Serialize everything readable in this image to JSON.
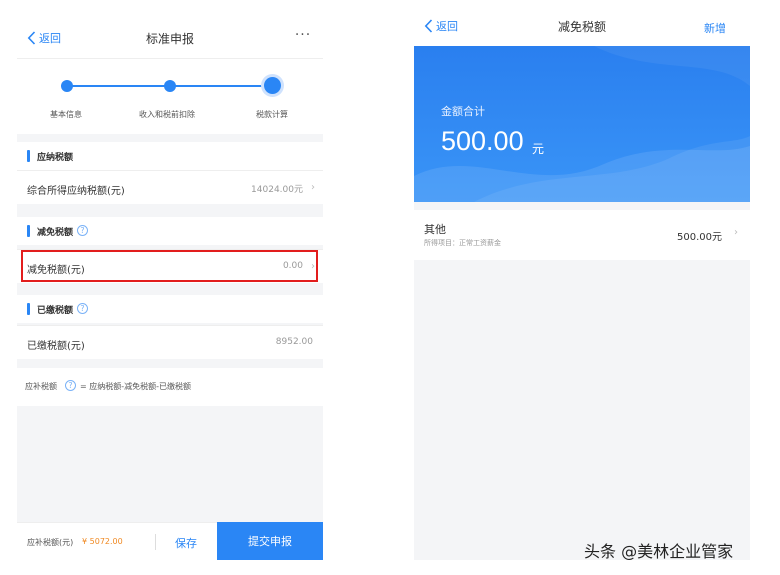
{
  "left": {
    "nav": {
      "back_label": "返回",
      "title": "标准申报",
      "more": "···"
    },
    "steps": [
      {
        "label": "基本信息"
      },
      {
        "label": "收入和税前扣除"
      },
      {
        "label": "税款计算"
      }
    ],
    "sections": {
      "payable": {
        "title": "应纳税额",
        "row_label": "综合所得应纳税额(元)",
        "row_value": "14024.00元"
      },
      "relief": {
        "title": "减免税额",
        "row_label": "减免税额(元)",
        "row_value": "0.00"
      },
      "paid": {
        "title": "已缴税额",
        "row_label": "已缴税额(元)",
        "row_value": "8952.00"
      }
    },
    "formula": {
      "prefix": "应补税额",
      "help": "?",
      "equation": "= 应纳税额-减免税额-已缴税额"
    },
    "footer": {
      "label": "应补税额(元)",
      "amount": "¥ 5072.00",
      "save": "保存",
      "submit": "提交申报"
    }
  },
  "right": {
    "nav": {
      "back_label": "返回",
      "title": "减免税额",
      "action": "新增"
    },
    "hero": {
      "label": "金额合计",
      "amount": "500.00",
      "unit": "元"
    },
    "item": {
      "title": "其他",
      "subtitle": "所得项目：正常工资薪金",
      "value": "500.00元"
    }
  },
  "watermark": "头条 @美林企业管家",
  "colors": {
    "accent": "#2a86f5",
    "highlight": "#e21d1d",
    "amount": "#f08a24"
  }
}
